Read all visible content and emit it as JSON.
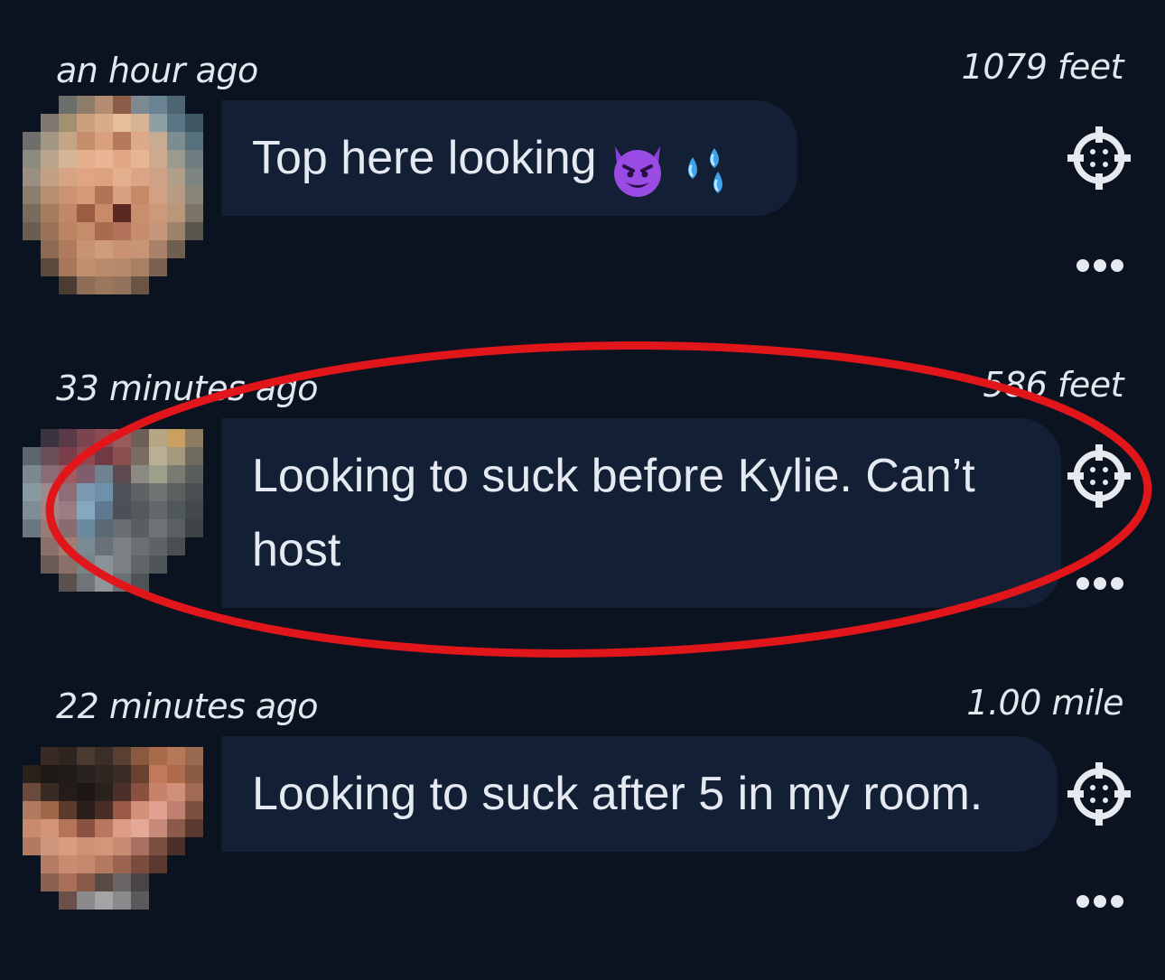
{
  "posts": [
    {
      "time": "an hour ago",
      "distance": "1079 feet",
      "message": "Top here looking",
      "emojis": [
        "smiling-devil-emoji",
        "sweat-droplets-emoji"
      ],
      "icons": {
        "locate": "crosshair-icon",
        "more": "ellipsis-icon"
      }
    },
    {
      "time": "33 minutes ago",
      "distance": "586 feet",
      "message": "Looking to suck before Kylie. Can’t\nhost",
      "icons": {
        "locate": "crosshair-icon",
        "more": "ellipsis-icon"
      }
    },
    {
      "time": "22 minutes ago",
      "distance": "1.00 mile",
      "message": "Looking to suck after 5 in my room.",
      "icons": {
        "locate": "crosshair-icon",
        "more": "ellipsis-icon"
      }
    }
  ],
  "annotation": {
    "shape": "ellipse",
    "color": "#e0161b",
    "target": "post 2"
  },
  "colors": {
    "background": "#0b1220",
    "bubble": "#131f35",
    "text": "#e5eaf2"
  }
}
